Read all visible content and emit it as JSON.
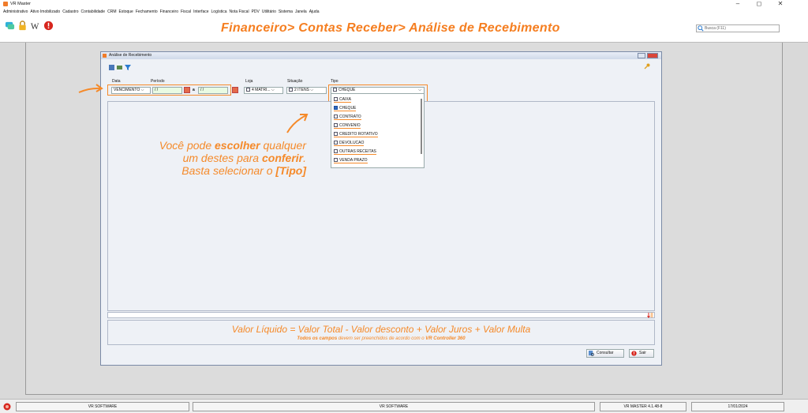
{
  "window": {
    "title": "VR Master",
    "minimize": "–",
    "maximize": "◻",
    "close": "✕"
  },
  "menu": [
    "Administrativo",
    "Ativo Imobilizado",
    "Cadastro",
    "Contabilidade",
    "CRM",
    "Estoque",
    "Fechamento",
    "Financeiro",
    "Fiscal",
    "Interface",
    "Logística",
    "Nota Fiscal",
    "PDV",
    "Utilitário",
    "Sistema",
    "Janela",
    "Ajuda"
  ],
  "toolbar": {
    "heading": "Financeiro> Contas Receber> Análise de Recebimento",
    "search_placeholder": "Busca (F11)"
  },
  "dialog": {
    "title": "Análise de Recebimento",
    "labels": {
      "data": "Data",
      "periodo": "Período",
      "loja": "Loja",
      "situacao": "Situação",
      "tipo": "Tipo"
    },
    "data_value": "VENCIMENTO",
    "periodo_start": " / /",
    "periodo_sep": "a",
    "periodo_end": " / /",
    "loja_value": "4 MATRI...",
    "situacao_value": "2 ITENS",
    "tipo_value": "CHEQUE",
    "tipo_options": [
      {
        "label": "CAIXA",
        "checked": false
      },
      {
        "label": "CHEQUE",
        "checked": true
      },
      {
        "label": "CONTRATO",
        "checked": false
      },
      {
        "label": "CONVENIO",
        "checked": false
      },
      {
        "label": "CREDITO ROTATIVO",
        "checked": false
      },
      {
        "label": "DEVOLUCAO",
        "checked": false
      },
      {
        "label": "OUTRAS RECEITAS",
        "checked": false
      },
      {
        "label": "VENDA PRAZO",
        "checked": false
      }
    ],
    "hint_line1_a": "Você pode ",
    "hint_line1_b": "escolher",
    "hint_line1_c": " qualquer",
    "hint_line2_a": "um destes para ",
    "hint_line2_b": "conferir",
    "hint_line2_c": ".",
    "hint_line3_a": "Basta selecionar o ",
    "hint_line3_b": "[Tipo]",
    "formula": "Valor Líquido = Valor Total - Valor desconto + Valor Juros + Valor Multa",
    "formula_sub_a": "Todos os campos",
    "formula_sub_b": " devem ser preenchidos de acordo com o ",
    "formula_sub_c": "VR Controller 360",
    "btn_consultar": "Consultar",
    "btn_sair": "Sair"
  },
  "statusbar": {
    "company1": "VR SOFTWARE",
    "company2": "VR SOFTWARE",
    "version": "VR MASTER 4.1.48-8",
    "date": "17/01/2024"
  },
  "colors": {
    "accent": "#f58a2a",
    "checked": "#3069c0"
  }
}
